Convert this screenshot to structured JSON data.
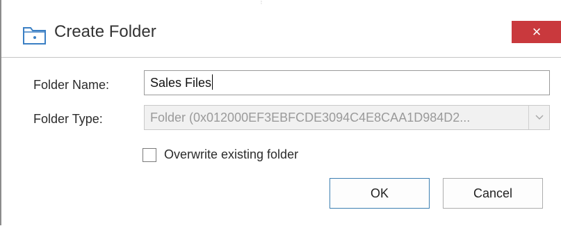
{
  "dialog": {
    "title": "Create Folder",
    "icon": "folder-plus-icon",
    "close_icon": "close-icon",
    "close_glyph": "×",
    "accent_color": "#c9393d"
  },
  "form": {
    "name_label": "Folder Name:",
    "name_value": "Sales Files",
    "type_label": "Folder Type:",
    "type_value": "Folder (0x012000EF3EBFCDE3094C4E8CAA1D984D2...",
    "type_disabled": true,
    "overwrite_label": "Overwrite existing folder",
    "overwrite_checked": false
  },
  "buttons": {
    "ok_label": "OK",
    "cancel_label": "Cancel"
  }
}
